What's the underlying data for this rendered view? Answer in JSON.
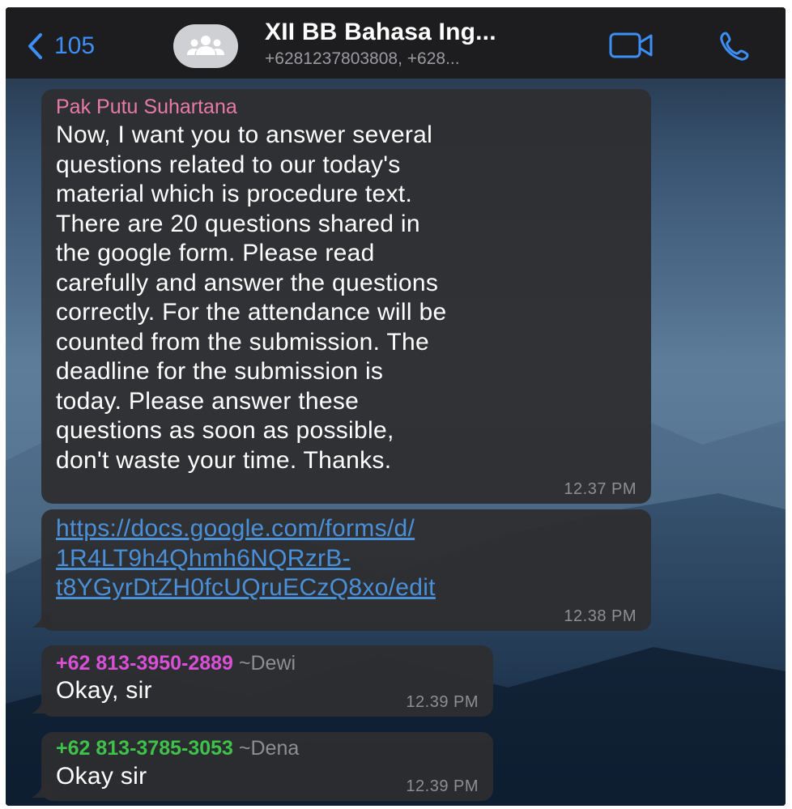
{
  "header": {
    "back_count": "105",
    "group_title": "XII BB Bahasa Ing...",
    "group_members": "+6281237803808, +628...",
    "icons": {
      "back": "chevron-left-icon",
      "avatar": "group-icon",
      "video": "video-call-icon",
      "voice": "phone-icon"
    }
  },
  "messages": [
    {
      "sender": "Pak Putu Suhartana",
      "sender_color": "#e87aa8",
      "text": "Now, I want you to answer several\nquestions related to our today's\nmaterial which is procedure text.\nThere are 20 questions shared in\nthe google form. Please read\ncarefully and answer the questions\ncorrectly. For the attendance will be\ncounted from the submission. The\ndeadline for the submission is\ntoday. Please answer these\nquestions as soon as possible,\ndon't waste your time. Thanks.",
      "time": "12.37 PM"
    },
    {
      "link": "https://docs.google.com/forms/d/\n1R4LT9h4Qhmh6NQRzrB-\nt8YGyrDtZH0fcUQruECzQ8xo/edit",
      "time": "12.38 PM"
    },
    {
      "sender": "+62 813-3950-2889",
      "sender_name": "~Dewi",
      "sender_color": "#d94fd6",
      "text": "Okay, sir",
      "time": "12.39 PM"
    },
    {
      "sender": "+62 813-3785-3053",
      "sender_name": "~Dena",
      "sender_color": "#3ec24a",
      "text": "Okay sir",
      "time": "12.39 PM"
    }
  ],
  "colors": {
    "accent": "#3d8ef7",
    "header_bg": "#1d1d1f",
    "bubble_bg": "#2e2e30"
  }
}
